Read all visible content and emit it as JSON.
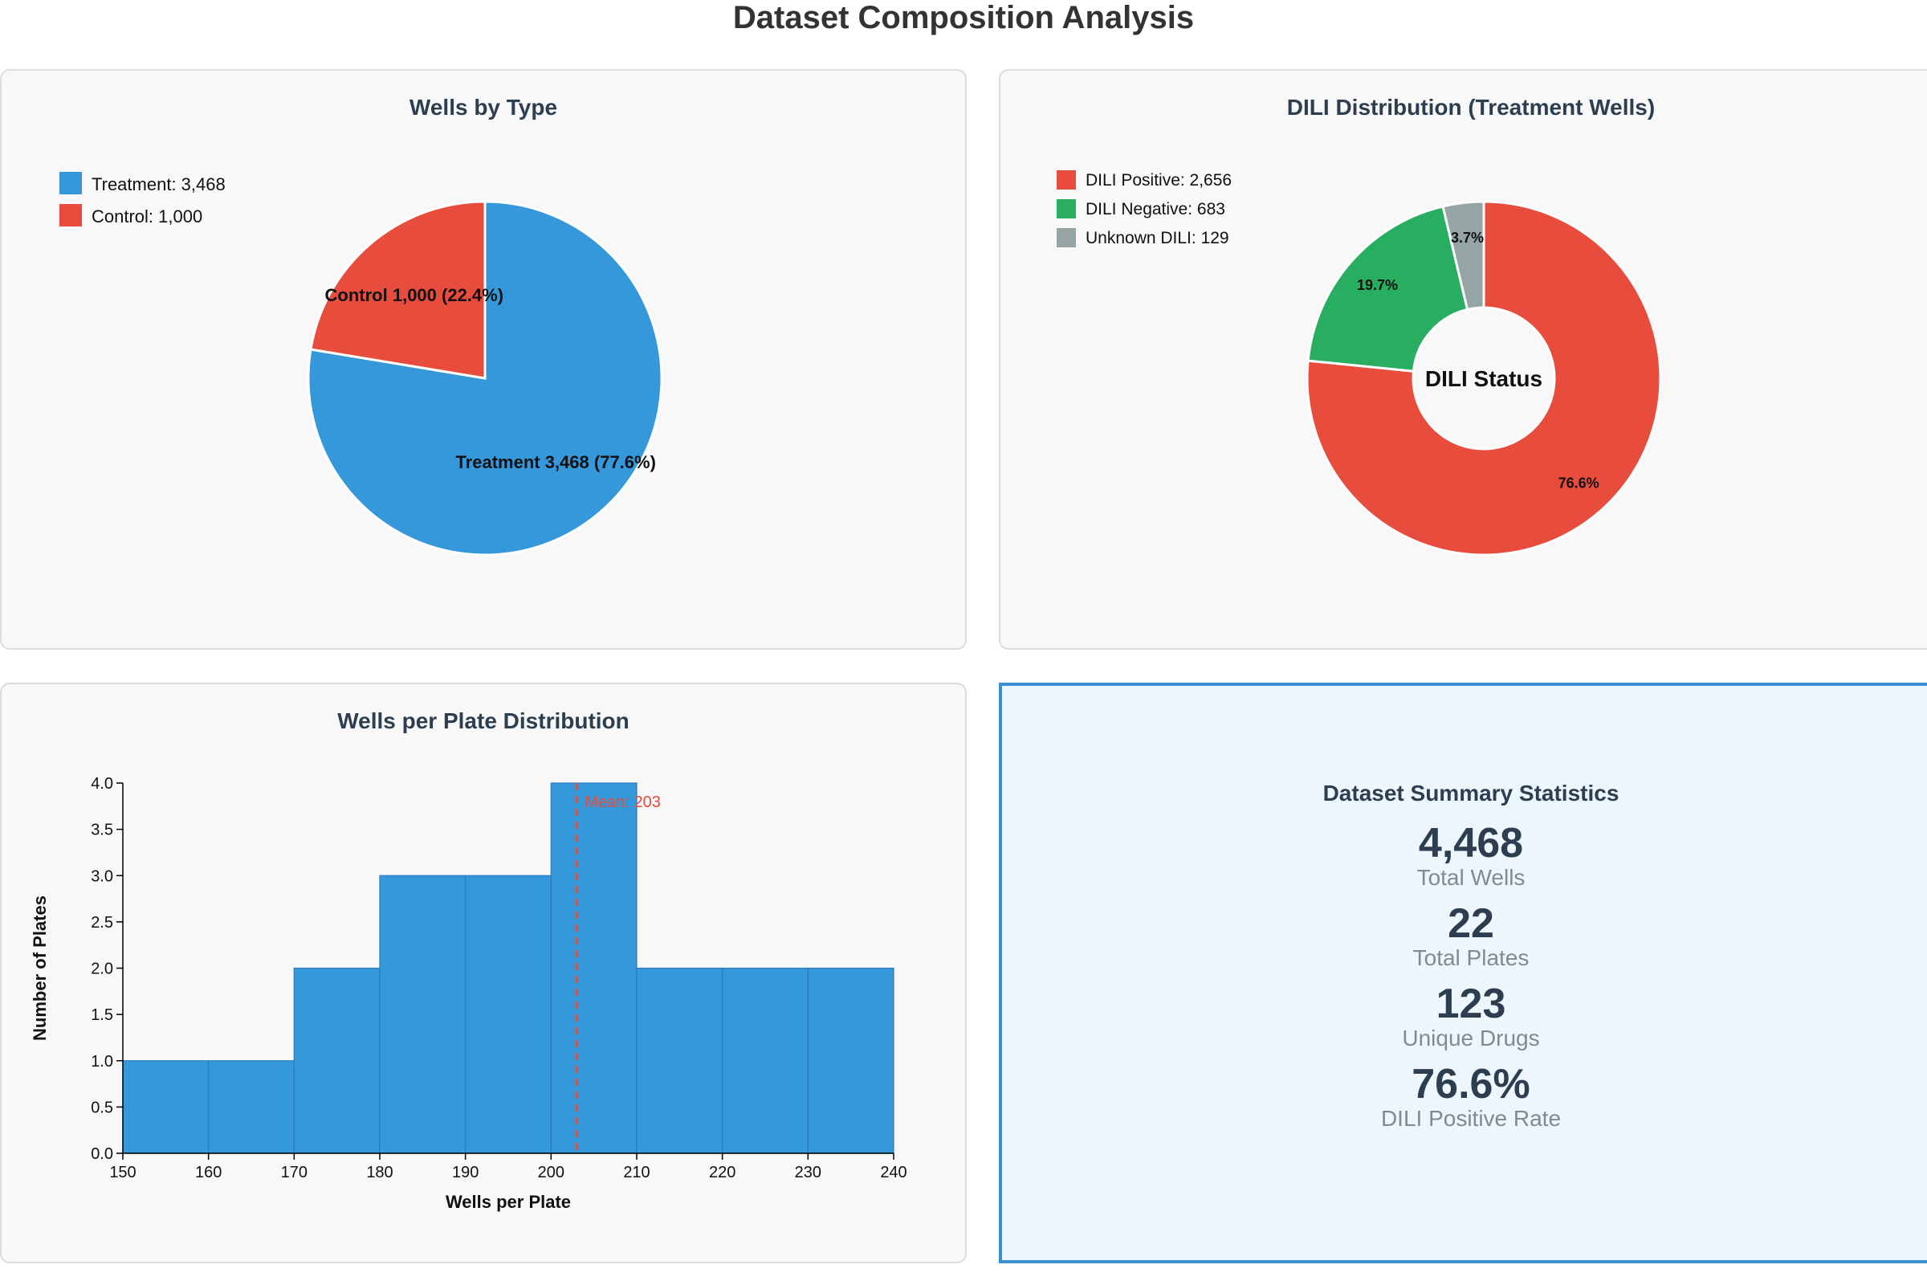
{
  "page_title": "Dataset Composition Analysis",
  "colors": {
    "treatment": "#3498db",
    "control": "#e74c3c",
    "dili_positive": "#e74c3c",
    "dili_negative": "#27ae60",
    "unknown_dili": "#95a5a6",
    "mean_line": "#e74c3c",
    "bar": "#3498db"
  },
  "chart_data": [
    {
      "type": "pie",
      "title": "Wells by Type",
      "legend": [
        "Treatment: 3,468",
        "Control: 1,000"
      ],
      "legend_position": "top-left",
      "slices": [
        {
          "name": "Treatment",
          "value": 3468,
          "label": "Treatment 3,468 (77.6%)",
          "color": "#3498db"
        },
        {
          "name": "Control",
          "value": 1000,
          "label": "Control 1,000 (22.4%)",
          "color": "#e74c3c"
        }
      ]
    },
    {
      "type": "pie",
      "subtype": "donut",
      "title": "DILI Distribution (Treatment Wells)",
      "center_label": "DILI Status",
      "legend": [
        "DILI Positive: 2,656",
        "DILI Negative: 683",
        "Unknown DILI: 129"
      ],
      "legend_position": "top-left",
      "slices": [
        {
          "name": "DILI Positive",
          "value": 2656,
          "label": "76.6%",
          "color": "#e74c3c"
        },
        {
          "name": "DILI Negative",
          "value": 683,
          "label": "19.7%",
          "color": "#27ae60"
        },
        {
          "name": "Unknown DILI",
          "value": 129,
          "label": "3.7%",
          "color": "#95a5a6"
        }
      ]
    },
    {
      "type": "bar",
      "subtype": "histogram",
      "title": "Wells per Plate Distribution",
      "xlabel": "Wells per Plate",
      "ylabel": "Number of Plates",
      "bins": [
        {
          "start": 150,
          "end": 160,
          "count": 1
        },
        {
          "start": 160,
          "end": 170,
          "count": 1
        },
        {
          "start": 170,
          "end": 180,
          "count": 2
        },
        {
          "start": 180,
          "end": 190,
          "count": 3
        },
        {
          "start": 190,
          "end": 200,
          "count": 3
        },
        {
          "start": 200,
          "end": 210,
          "count": 4
        },
        {
          "start": 210,
          "end": 220,
          "count": 2
        },
        {
          "start": 220,
          "end": 230,
          "count": 2
        },
        {
          "start": 230,
          "end": 240,
          "count": 2
        }
      ],
      "xlim": [
        150,
        240
      ],
      "ylim": [
        0,
        4
      ],
      "xticks": [
        "150",
        "160",
        "170",
        "180",
        "190",
        "200",
        "210",
        "220",
        "230",
        "240"
      ],
      "yticks": [
        "0.0",
        "0.5",
        "1.0",
        "1.5",
        "2.0",
        "2.5",
        "3.0",
        "3.5",
        "4.0"
      ],
      "mean": {
        "value": 203,
        "label": "Mean: 203"
      }
    }
  ],
  "summary": {
    "title": "Dataset Summary Statistics",
    "stats": [
      {
        "value": "4,468",
        "label": "Total Wells"
      },
      {
        "value": "22",
        "label": "Total Plates"
      },
      {
        "value": "123",
        "label": "Unique Drugs"
      },
      {
        "value": "76.6%",
        "label": "DILI Positive Rate"
      }
    ]
  }
}
